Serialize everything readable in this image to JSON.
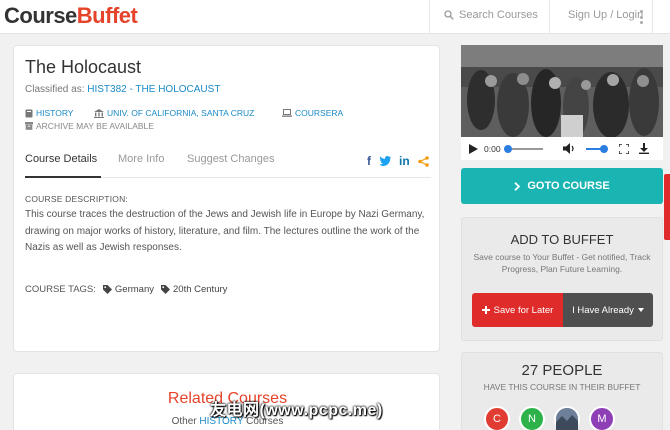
{
  "brand": {
    "part1": "Course",
    "part2": "Buffet"
  },
  "nav": {
    "search": "Search Courses",
    "signup": "Sign Up / Login"
  },
  "course": {
    "title": "The Holocaust",
    "classified_prefix": "Classified as:",
    "classified_value": "HIST382 - THE HOLOCAUST",
    "subject": "HISTORY",
    "university": "UNIV. OF CALIFORNIA, SANTA CRUZ",
    "provider": "COURSERA",
    "archive": "ARCHIVE MAY BE AVAILABLE"
  },
  "tabs": [
    "Course Details",
    "More Info",
    "Suggest Changes"
  ],
  "share": {
    "facebook": "f",
    "linkedin": "in"
  },
  "description": {
    "label": "COURSE DESCRIPTION:",
    "text": "This course traces the destruction of the Jews and Jewish life in Europe by Nazi Germany, drawing on major works of history, literature, and film. The lectures outline the work of the Nazis as well as Jewish responses."
  },
  "tags": {
    "label": "COURSE TAGS:",
    "items": [
      "Germany",
      "20th Century"
    ]
  },
  "related": {
    "title": "Related Courses",
    "sub_prefix": "Other",
    "sub_link": "HISTORY",
    "sub_suffix": "Courses"
  },
  "video": {
    "time": "0:00"
  },
  "goto": {
    "label": "GOTO COURSE"
  },
  "add_buffet": {
    "title": "ADD TO BUFFET",
    "desc": "Save course to Your Buffet - Get notified, Track Progress, Plan Future Learning.",
    "save_later": "Save for Later",
    "have_already": "I Have Already"
  },
  "people": {
    "count": "27 PEOPLE",
    "sub": "HAVE THIS COURSE IN THEIR BUFFET",
    "avatars": [
      {
        "initial": "C",
        "color": "#e03c31"
      },
      {
        "initial": "N",
        "color": "#2db34a"
      },
      {
        "initial": "",
        "color": "#7a8da8"
      },
      {
        "initial": "M",
        "color": "#8e3fb5"
      }
    ]
  },
  "watermark": "友电网(www.pcpc.me)"
}
